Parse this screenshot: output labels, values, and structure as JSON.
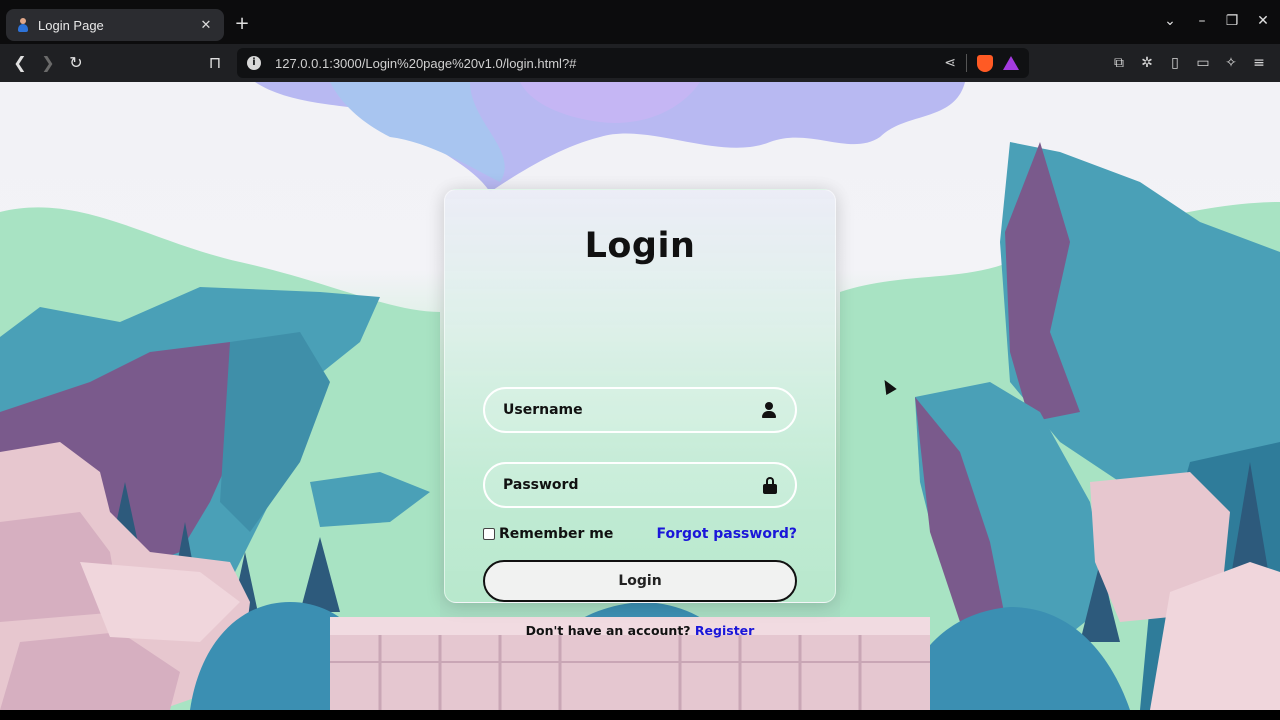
{
  "browser": {
    "tab_title": "Login Page",
    "tab_close": "✕",
    "new_tab": "+",
    "url": "127.0.0.1:3000/Login%20page%20v1.0/login.html?#",
    "window_controls": [
      "⌄",
      "–",
      "❐",
      "✕"
    ]
  },
  "colors": {
    "link": "#1a16d9",
    "accent_blue": "#2e73d8",
    "brave_orange": "#ff5a24",
    "rewards_purple": "#a43be0"
  },
  "login": {
    "title": "Login",
    "username_placeholder": "Username",
    "password_placeholder": "Password",
    "remember_label": "Remember me",
    "forgot_label": "Forgot password?",
    "submit_label": "Login",
    "register_prompt": "Don't have an account?",
    "register_label": "Register"
  }
}
